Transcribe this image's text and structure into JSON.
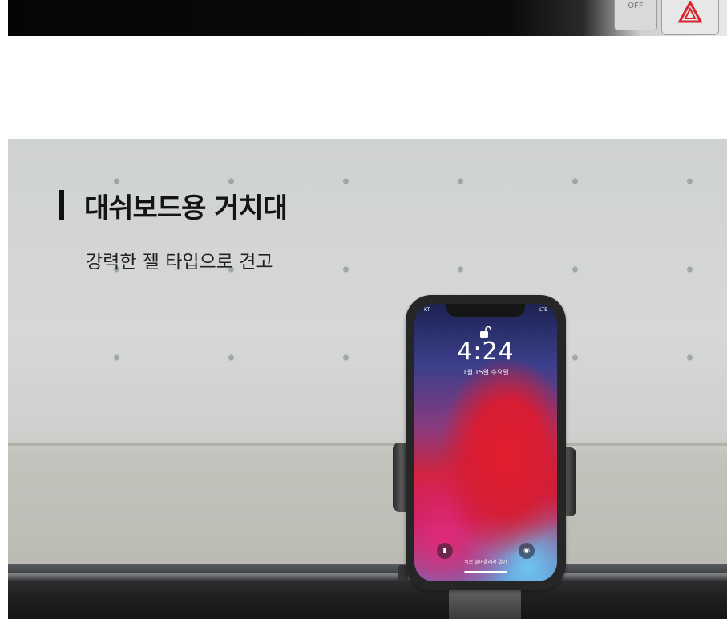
{
  "top_photo": {
    "button_label": "OFF"
  },
  "section": {
    "title": "대쉬보드용 거치대",
    "subtitle": "강력한 젤 타입으로 견고"
  },
  "phone": {
    "time": "4:24",
    "date": "1월 15일 수요일",
    "status_left": "KT",
    "status_right": "LTE",
    "swipe_hint": "위로 쓸어올려서 열기",
    "icons": [
      "lock-open-icon",
      "flashlight-icon",
      "camera-icon"
    ]
  },
  "colors": {
    "title": "#141414",
    "hazard": "#d8262d"
  }
}
